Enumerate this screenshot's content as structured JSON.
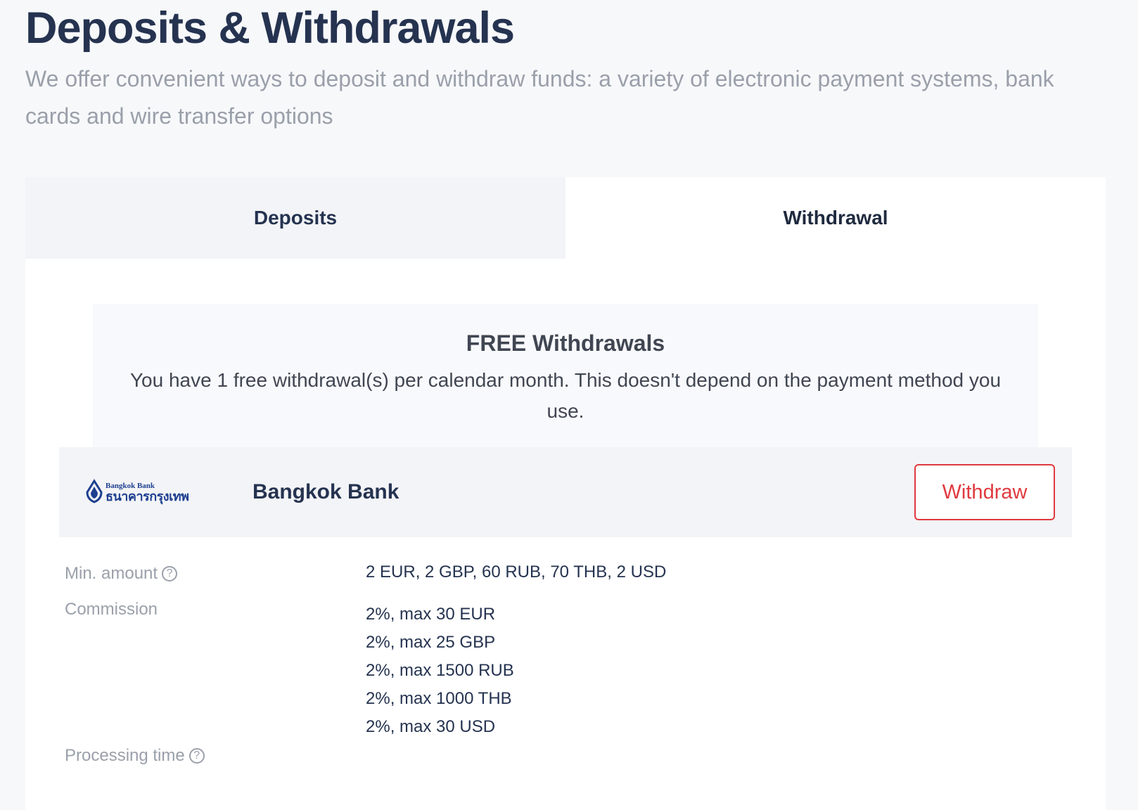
{
  "header": {
    "title": "Deposits & Withdrawals",
    "subtitle": "We offer convenient ways to deposit and withdraw funds: a variety of electronic payment systems, bank cards and wire transfer options"
  },
  "tabs": [
    {
      "label": "Deposits",
      "active": false
    },
    {
      "label": "Withdrawal",
      "active": true
    }
  ],
  "notice": {
    "title": "FREE Withdrawals",
    "text": "You have 1 free withdrawal(s) per calendar month. This doesn't depend on the payment method you use."
  },
  "method": {
    "logo_text_en": "Bangkok Bank",
    "logo_text_th": "ธนาคารกรุงเทพ",
    "name": "Bangkok Bank",
    "button_label": "Withdraw"
  },
  "details": {
    "min_amount_label": "Min. amount",
    "min_amount_value": "2 EUR, 2 GBP, 60 RUB, 70 THB, 2 USD",
    "commission_label": "Commission",
    "commission_values": [
      "2%, max 30 EUR",
      "2%, max 25 GBP",
      "2%, max 1500 RUB",
      "2%, max 1000 THB",
      "2%, max 30 USD"
    ],
    "processing_time_label": "Processing time",
    "help_icon_glyph": "?"
  },
  "colors": {
    "accent": "#e0393e",
    "heading": "#253350",
    "muted": "#9aa0aa",
    "logo_blue": "#1e3f8f"
  }
}
